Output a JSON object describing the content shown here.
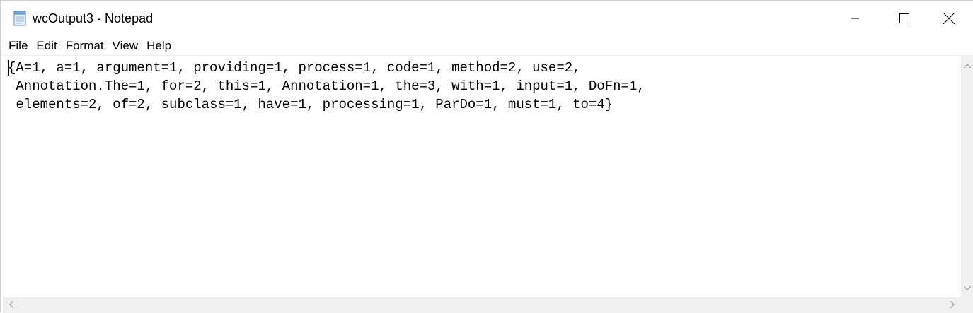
{
  "window": {
    "title": "wcOutput3 - Notepad"
  },
  "menu": {
    "items": [
      "File",
      "Edit",
      "Format",
      "View",
      "Help"
    ]
  },
  "editor": {
    "lines": [
      "{A=1, a=1, argument=1, providing=1, process=1, code=1, method=2, use=2,",
      " Annotation.The=1, for=2, this=1, Annotation=1, the=3, with=1, input=1, DoFn=1,",
      " elements=2, of=2, subclass=1, have=1, processing=1, ParDo=1, must=1, to=4}"
    ]
  },
  "icons": {
    "app": "notepad-icon",
    "minimize": "minimize-icon",
    "maximize": "maximize-icon",
    "close": "close-icon",
    "scroll_up": "chevron-up-icon",
    "scroll_down": "chevron-down-icon",
    "scroll_left": "chevron-left-icon",
    "scroll_right": "chevron-right-icon"
  },
  "colors": {
    "text": "#000000",
    "background": "#ffffff",
    "scrollbar": "#f0f0f0"
  }
}
